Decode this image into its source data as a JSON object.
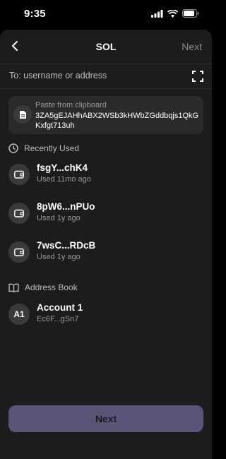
{
  "status_bar": {
    "time": "9:35",
    "icons": [
      "signal-icon",
      "wifi-icon",
      "battery-icon"
    ]
  },
  "nav": {
    "back_icon": "chevron-left-icon",
    "title": "SOL",
    "next_label": "Next"
  },
  "recipient": {
    "placeholder": "To: username or address",
    "scan_icon": "scan-icon"
  },
  "clipboard": {
    "icon": "document-icon",
    "label": "Paste from clipboard",
    "address": "3ZA5gEJAHhABX2WSb3kHWbZGddbqjs1QkGKxfgt713uh"
  },
  "recently_used": {
    "icon": "clock-icon",
    "title": "Recently Used",
    "items": [
      {
        "icon": "wallet-icon",
        "name": "fsgY...chK4",
        "sub": "Used 11mo ago"
      },
      {
        "icon": "wallet-icon",
        "name": "8pW6...nPUo",
        "sub": "Used 1y ago"
      },
      {
        "icon": "wallet-icon",
        "name": "7wsC...RDcB",
        "sub": "Used 1y ago"
      }
    ]
  },
  "address_book": {
    "icon": "book-icon",
    "title": "Address Book",
    "items": [
      {
        "avatar": "A1",
        "name": "Account 1",
        "sub": "Ec6F...gSn7"
      }
    ]
  },
  "footer": {
    "next_label": "Next"
  },
  "colors": {
    "background": "#1c1c1c",
    "card": "#2a2a2a",
    "button_disabled": "#5b5378"
  }
}
